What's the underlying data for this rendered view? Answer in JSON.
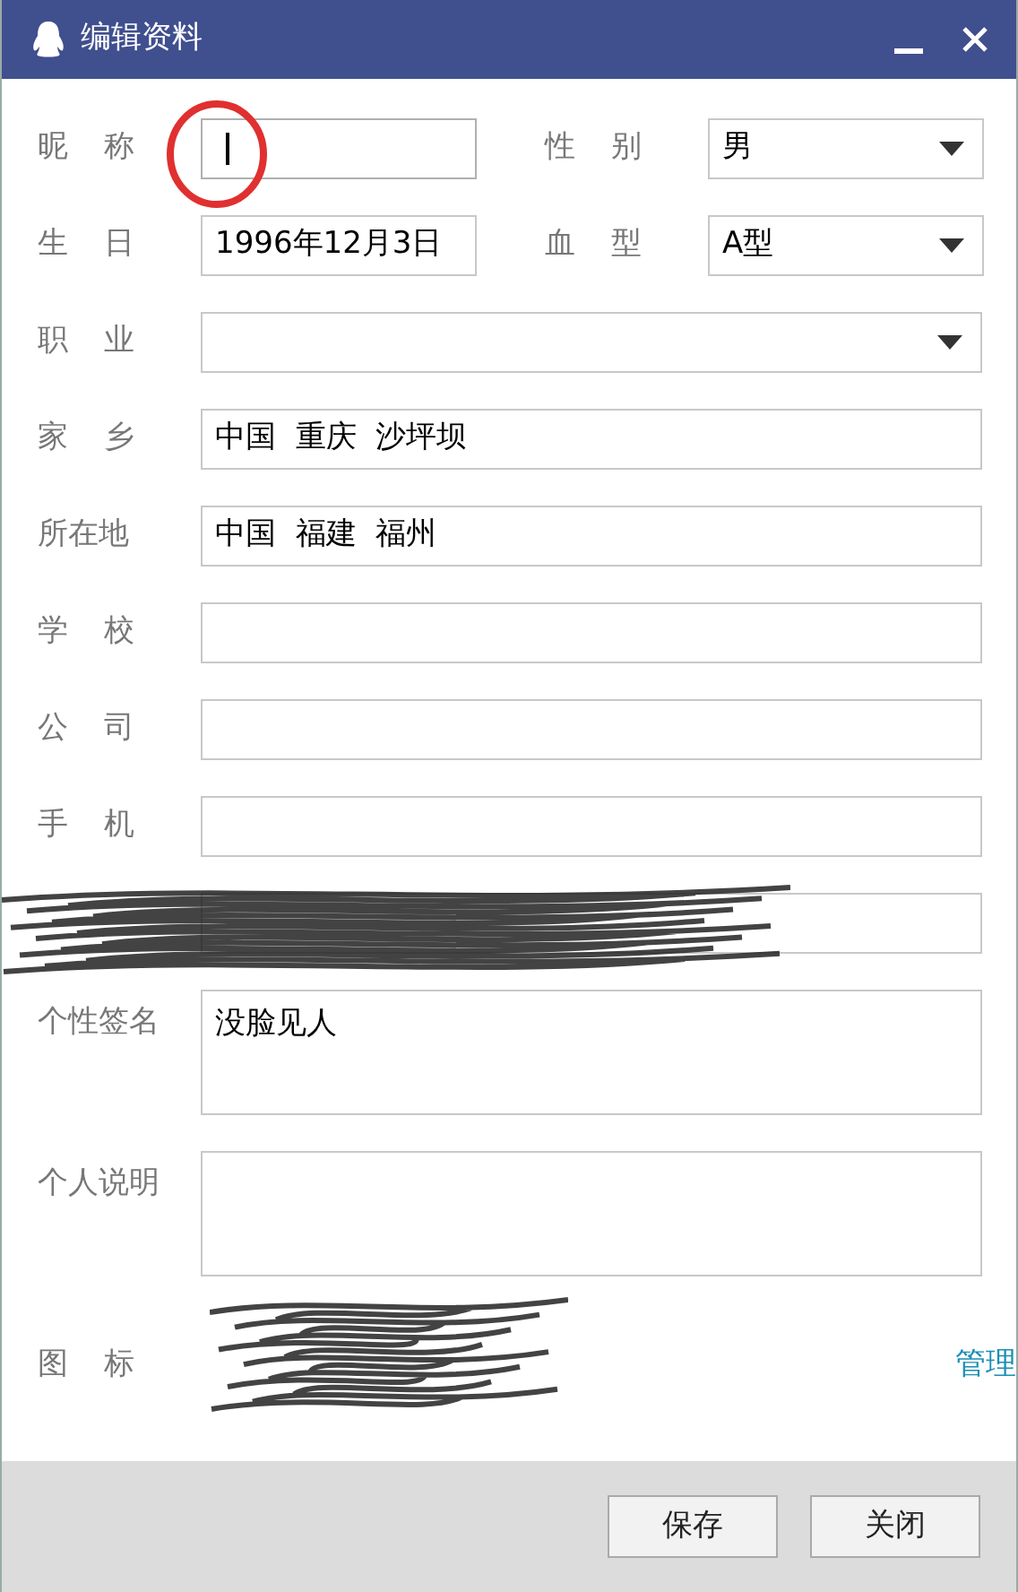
{
  "window": {
    "title": "编辑资料"
  },
  "rows": [
    {
      "kind": "pair",
      "left": {
        "label": "昵称",
        "spaced": true,
        "kind": "text",
        "focused": true
      },
      "right": {
        "label": "性别",
        "spaced": true,
        "kind": "select",
        "value": "男"
      }
    },
    {
      "kind": "pair",
      "left": {
        "label": "生日",
        "spaced": true,
        "kind": "text",
        "value": "1996年12月3日"
      },
      "right": {
        "label": "血型",
        "spaced": true,
        "kind": "select",
        "value": "A型"
      }
    },
    {
      "kind": "select",
      "label": "职业",
      "spaced": true
    },
    {
      "kind": "text",
      "label": "家乡",
      "spaced": true,
      "value": "中国  重庆  沙坪坝"
    },
    {
      "kind": "text",
      "label": "所在地",
      "spaced": false,
      "value": "中国  福建  福州"
    },
    {
      "kind": "text",
      "label": "学校",
      "spaced": true
    },
    {
      "kind": "text",
      "label": "公司",
      "spaced": true
    },
    {
      "kind": "text",
      "label": "手机",
      "spaced": true
    },
    {
      "kind": "hidden"
    },
    {
      "kind": "textarea",
      "label": "个性签名",
      "spaced": false,
      "value": "没脸见人"
    },
    {
      "kind": "textarea",
      "label": "个人说明",
      "spaced": false
    },
    {
      "kind": "icons",
      "label": "图标",
      "spaced": true,
      "link": "管理"
    }
  ],
  "buttons": [
    {
      "label": "保存"
    },
    {
      "label": "关闭"
    }
  ]
}
